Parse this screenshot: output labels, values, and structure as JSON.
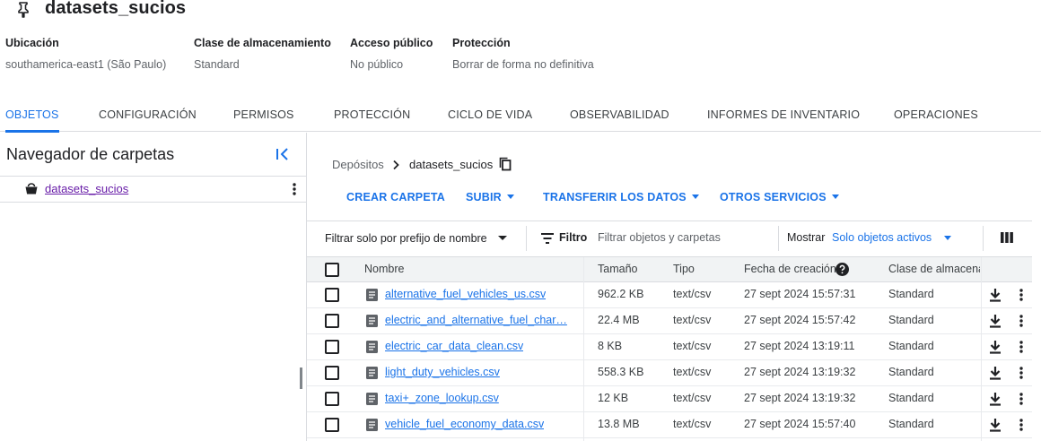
{
  "bucket": {
    "name": "datasets_sucios",
    "meta": [
      {
        "label": "Ubicación",
        "value": "southamerica-east1 (São Paulo)"
      },
      {
        "label": "Clase de almacenamiento",
        "value": "Standard"
      },
      {
        "label": "Acceso público",
        "value": "No público"
      },
      {
        "label": "Protección",
        "value": "Borrar de forma no definitiva"
      }
    ]
  },
  "tabs": [
    {
      "label": "OBJETOS",
      "active": true
    },
    {
      "label": "CONFIGURACIÓN"
    },
    {
      "label": "PERMISOS"
    },
    {
      "label": "PROTECCIÓN"
    },
    {
      "label": "CICLO DE VIDA"
    },
    {
      "label": "OBSERVABILIDAD"
    },
    {
      "label": "INFORMES DE INVENTARIO"
    },
    {
      "label": "OPERACIONES"
    }
  ],
  "folder_browser": {
    "title": "Navegador de carpetas",
    "bucket_item": "datasets_sucios"
  },
  "breadcrumb": {
    "root": "Depósitos",
    "current": "datasets_sucios"
  },
  "actions": {
    "create_folder": "CREAR CARPETA",
    "upload": "SUBIR",
    "transfer": "TRANSFERIR LOS DATOS",
    "other": "OTROS SERVICIOS"
  },
  "filter": {
    "prefix_label": "Filtrar solo por prefijo de nombre",
    "filter_label": "Filtro",
    "placeholder": "Filtrar objetos y carpetas",
    "show_label": "Mostrar",
    "show_value": "Solo objetos activos"
  },
  "table": {
    "headers": [
      "Nombre",
      "Tamaño",
      "Tipo",
      "Fecha de creación",
      "Clase de almacena"
    ],
    "rows": [
      {
        "name": "alternative_fuel_vehicles_us.csv",
        "size": "962.2 KB",
        "type": "text/csv",
        "created": "27 sept 2024 15:57:31",
        "class": "Standard"
      },
      {
        "name": "electric_and_alternative_fuel_char…",
        "size": "22.4 MB",
        "type": "text/csv",
        "created": "27 sept 2024 15:57:42",
        "class": "Standard"
      },
      {
        "name": "electric_car_data_clean.csv",
        "size": "8 KB",
        "type": "text/csv",
        "created": "27 sept 2024 13:19:11",
        "class": "Standard"
      },
      {
        "name": "light_duty_vehicles.csv",
        "size": "558.3 KB",
        "type": "text/csv",
        "created": "27 sept 2024 13:19:32",
        "class": "Standard"
      },
      {
        "name": "taxi+_zone_lookup.csv",
        "size": "12 KB",
        "type": "text/csv",
        "created": "27 sept 2024 13:19:32",
        "class": "Standard"
      },
      {
        "name": "vehicle_fuel_economy_data.csv",
        "size": "13.8 MB",
        "type": "text/csv",
        "created": "27 sept 2024 15:57:40",
        "class": "Standard"
      }
    ]
  },
  "colors": {
    "accent": "#1a73e8",
    "visited_link": "#681da8"
  }
}
